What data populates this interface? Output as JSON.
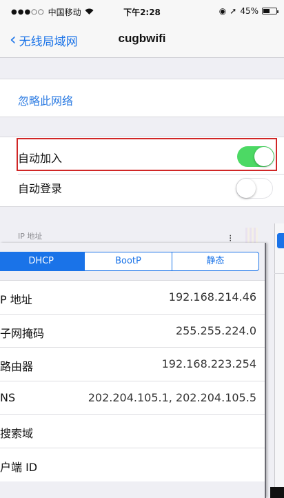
{
  "status_bar": {
    "carrier": "中国移动",
    "time": "下午2:28",
    "battery": "45%"
  },
  "nav": {
    "back_label": "无线局域网",
    "title": "cugbwifi"
  },
  "settings": {
    "forget_label": "忽略此网络",
    "auto_join_label": "自动加入",
    "auto_join_on": true,
    "auto_login_label": "自动登录",
    "auto_login_on": false,
    "ip_section_header": "IP 地址"
  },
  "ip_panel": {
    "tabs": [
      "DHCP",
      "BootP",
      "静态"
    ],
    "selected_tab": "DHCP",
    "rows": [
      {
        "label": "P 地址",
        "value": "192.168.214.46"
      },
      {
        "label": "子网掩码",
        "value": "255.255.224.0"
      },
      {
        "label": "路由器",
        "value": "192.168.223.254"
      },
      {
        "label": "NS",
        "value": "202.204.105.1, 202.204.105.5"
      },
      {
        "label": "搜索域",
        "value": ""
      },
      {
        "label": "户端 ID",
        "value": ""
      }
    ]
  },
  "colors": {
    "accent": "#1a73e8",
    "toggle_on": "#4cd964",
    "highlight_box": "#d02626"
  }
}
